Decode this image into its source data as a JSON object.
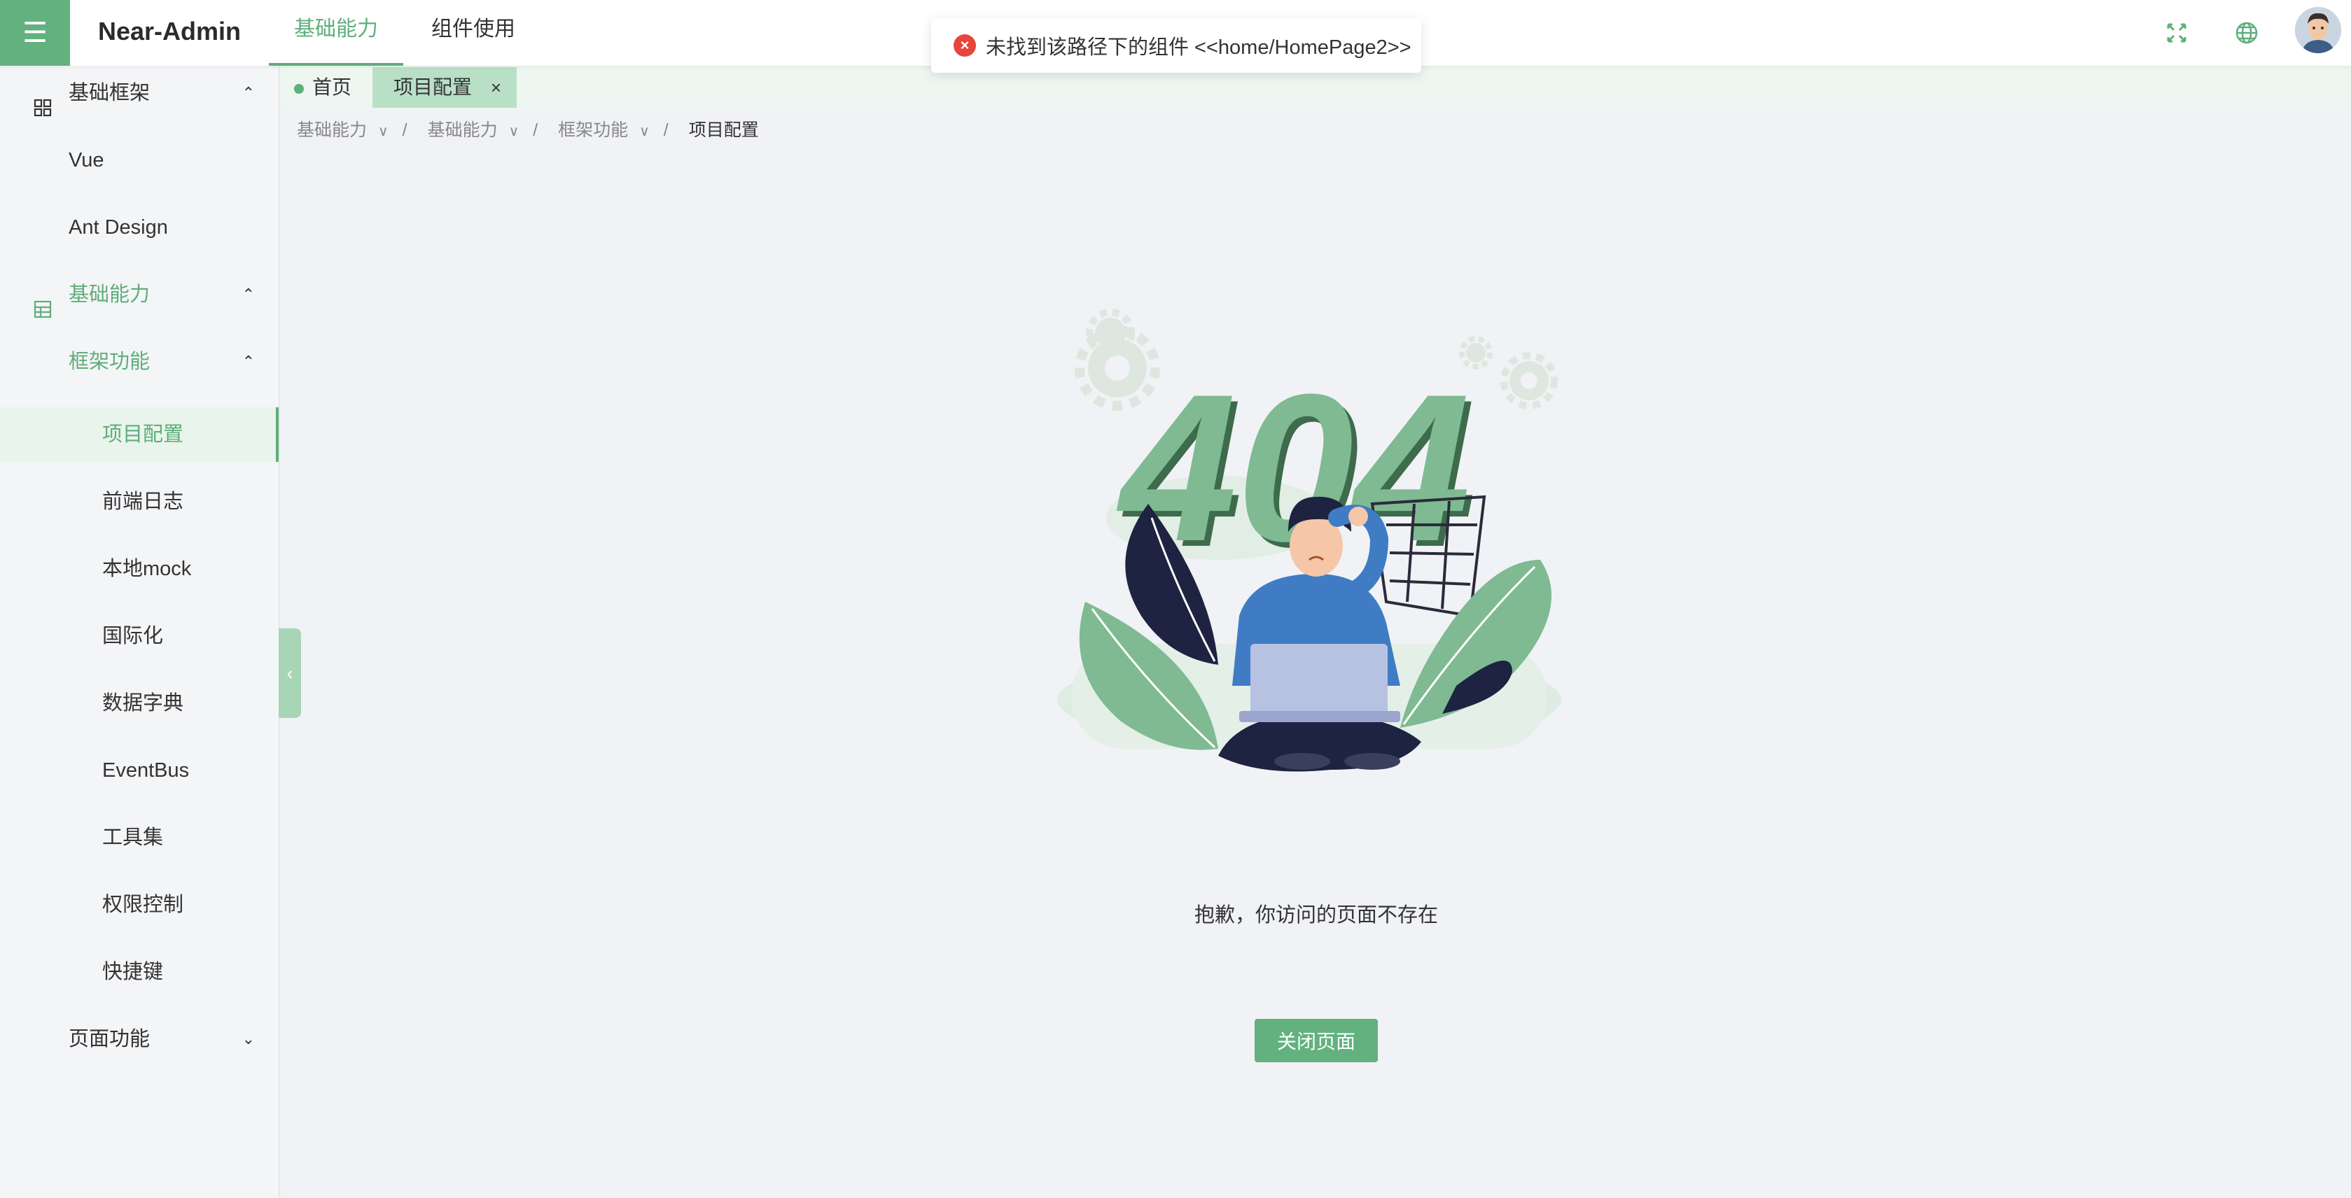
{
  "header": {
    "menu_icon": "menu-icon",
    "app_title": "Near-Admin",
    "tabs": [
      {
        "label": "基础能力",
        "active": true
      },
      {
        "label": "组件使用",
        "active": false
      }
    ],
    "icons": [
      "fullscreen-icon",
      "globe-icon",
      "avatar"
    ]
  },
  "toast": {
    "type": "error",
    "text": "未找到该路径下的组件 <<home/HomePage2>>"
  },
  "sidebar": {
    "items": [
      {
        "label": "基础框架",
        "level": 1,
        "icon": "grid-icon",
        "arrow": "up"
      },
      {
        "label": "Vue",
        "level": 2
      },
      {
        "label": "Ant Design",
        "level": 2
      },
      {
        "label": "基础能力",
        "level": 1,
        "icon": "table-icon",
        "arrow": "up",
        "highlight": true
      },
      {
        "label": "框架功能",
        "level": 2,
        "arrow": "up",
        "highlight": true
      },
      {
        "label": "项目配置",
        "level": 3,
        "selected": true
      },
      {
        "label": "前端日志",
        "level": 3
      },
      {
        "label": "本地mock",
        "level": 3
      },
      {
        "label": "国际化",
        "level": 3
      },
      {
        "label": "数据字典",
        "level": 3
      },
      {
        "label": "EventBus",
        "level": 3
      },
      {
        "label": "工具集",
        "level": 3
      },
      {
        "label": "权限控制",
        "level": 3
      },
      {
        "label": "快捷键",
        "level": 3
      },
      {
        "label": "页面功能",
        "level": 2,
        "arrow": "down"
      }
    ]
  },
  "tabbar": {
    "tabs": [
      {
        "label": "首页"
      },
      {
        "label": "项目配置",
        "close": "×"
      }
    ]
  },
  "breadcrumb": [
    "基础能力",
    "基础能力",
    "框架功能",
    "项目配置"
  ],
  "content": {
    "illustration_text": "404",
    "message": "抱歉，你访问的页面不存在",
    "close_button": "关闭页面"
  },
  "colors": {
    "accent": "#62b17e",
    "error": "#e8453c"
  }
}
